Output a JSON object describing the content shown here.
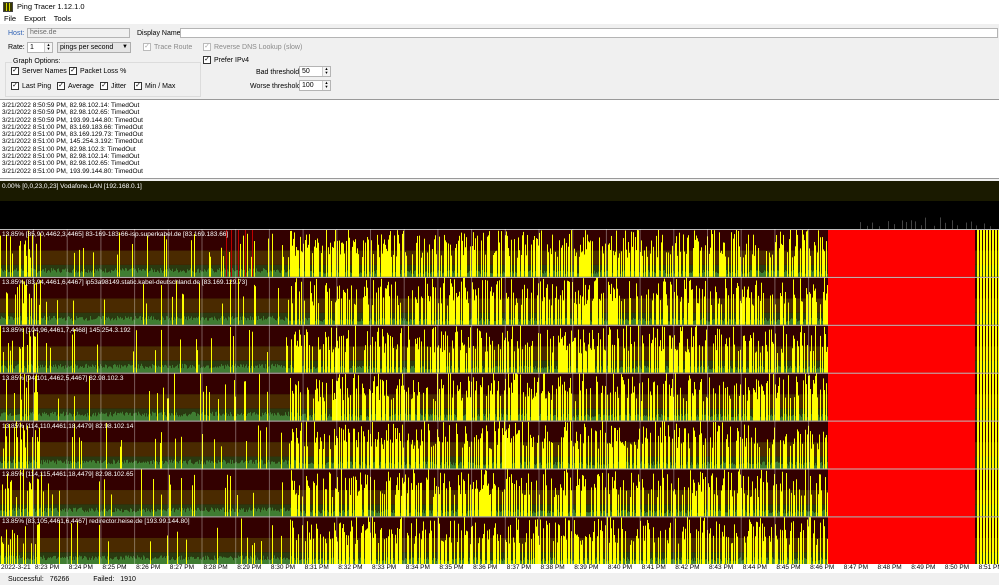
{
  "window": {
    "title": "Ping Tracer 1.12.1.0"
  },
  "menu": [
    "File",
    "Export",
    "Tools"
  ],
  "settings": {
    "host_label": "Host:",
    "host_value": "heise.de",
    "display_name_label": "Display Name:",
    "display_name_value": "",
    "rate_label": "Rate:",
    "rate_value": "1",
    "rate_unit": "pings per second",
    "trace_route": "Trace Route",
    "reverse_dns": "Reverse DNS Lookup (slow)",
    "prefer_ipv4": "Prefer IPv4",
    "graph_options_label": "Graph Options:",
    "server_names": "Server Names",
    "packet_loss": "Packet Loss %",
    "last_ping": "Last Ping",
    "average": "Average",
    "jitter": "Jitter",
    "min_max": "Min / Max",
    "bad_threshold_label": "Bad threshold:",
    "bad_threshold_value": "50",
    "worse_threshold_label": "Worse threshold:",
    "worse_threshold_value": "100"
  },
  "log": [
    "3/21/2022 8:50:59 PM, 82.98.102.14: TimedOut",
    "3/21/2022 8:50:59 PM, 82.98.102.65: TimedOut",
    "3/21/2022 8:50:59 PM, 193.99.144.80: TimedOut",
    "3/21/2022 8:51:00 PM, 83.169.183.66: TimedOut",
    "3/21/2022 8:51:00 PM, 83.169.129.73: TimedOut",
    "3/21/2022 8:51:00 PM, 145.254.3.192: TimedOut",
    "3/21/2022 8:51:00 PM, 82.98.102.3: TimedOut",
    "3/21/2022 8:51:00 PM, 82.98.102.14: TimedOut",
    "3/21/2022 8:51:00 PM, 82.98.102.65: TimedOut",
    "3/21/2022 8:51:00 PM, 193.99.144.80: TimedOut"
  ],
  "hosts": [
    {
      "label": "0.00% [0,0,23,0,23] Vodafone.LAN [192.168.0.1]",
      "loss_pct": 0
    },
    {
      "label": "13.85% [85,90,4462,3,4465] 83-169-183-66-isp.superkabel.de [83.169.183.66]",
      "loss_pct": 13.85
    },
    {
      "label": "13.85% [83,94,4461,6,4467] ip53a98149.static.kabel-deutschland.de [83.169.129.73]",
      "loss_pct": 13.85
    },
    {
      "label": "13.85% [104,96,4461,7,4468] 145.254.3.192",
      "loss_pct": 13.85
    },
    {
      "label": "13.85% [94,101,4462,5,4467] 82.98.102.3",
      "loss_pct": 13.85
    },
    {
      "label": "13.85% [114,110,4461,18,4479] 82.98.102.14",
      "loss_pct": 13.85
    },
    {
      "label": "13.85% [114,115,4461,18,4479] 82.98.102.65",
      "loss_pct": 13.85
    },
    {
      "label": "13.85% [83,105,4461,6,4467] redirector.heise.de [193.99.144.80]",
      "loss_pct": 13.85
    }
  ],
  "colors": {
    "good": "#3f7d32",
    "bad_band": "#4a2a00",
    "worse_band": "#330000",
    "spike": "#ffff00",
    "timeout": "#ff0000"
  },
  "time_axis": [
    "2022-3-21",
    "8:23 PM",
    "8:24 PM",
    "8:25 PM",
    "8:26 PM",
    "8:27 PM",
    "8:28 PM",
    "8:29 PM",
    "8:30 PM",
    "8:31 PM",
    "8:32 PM",
    "8:33 PM",
    "8:34 PM",
    "8:35 PM",
    "8:36 PM",
    "8:37 PM",
    "8:38 PM",
    "8:39 PM",
    "8:40 PM",
    "8:41 PM",
    "8:42 PM",
    "8:43 PM",
    "8:44 PM",
    "8:45 PM",
    "8:46 PM",
    "8:47 PM",
    "8:48 PM",
    "8:49 PM",
    "8:50 PM",
    "8:51 PM"
  ],
  "status": {
    "successful_label": "Successful:",
    "successful_value": "76266",
    "failed_label": "Failed:",
    "failed_value": "1910"
  }
}
